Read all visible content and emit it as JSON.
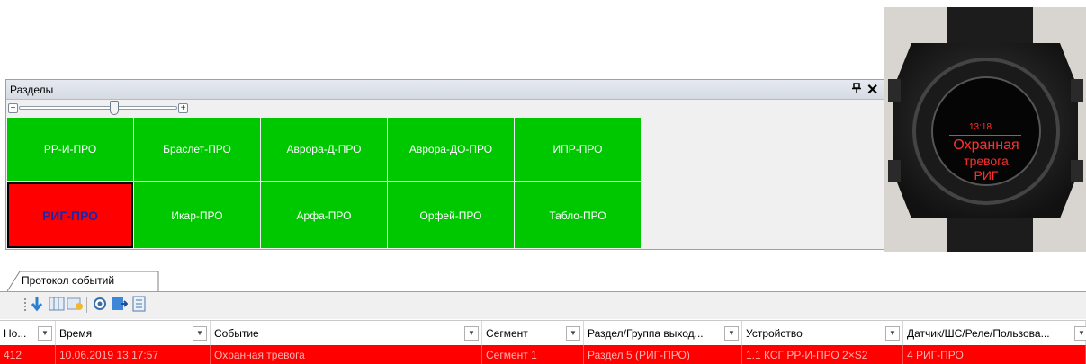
{
  "sections_panel": {
    "title": "Разделы",
    "pin_glyph": "ꟼ",
    "close_glyph": "✕",
    "zoom": {
      "minus": "−",
      "plus": "+",
      "level": 0.6
    },
    "tiles": [
      {
        "label": "РР-И-ПРО",
        "state": "normal"
      },
      {
        "label": "Браслет-ПРО",
        "state": "normal"
      },
      {
        "label": "Аврора-Д-ПРО",
        "state": "normal"
      },
      {
        "label": "Аврора-ДО-ПРО",
        "state": "normal"
      },
      {
        "label": "ИПР-ПРО",
        "state": "normal"
      },
      {
        "label": "РИГ-ПРО",
        "state": "alarm"
      },
      {
        "label": "Икар-ПРО",
        "state": "normal"
      },
      {
        "label": "Арфа-ПРО",
        "state": "normal"
      },
      {
        "label": "Орфей-ПРО",
        "state": "normal"
      },
      {
        "label": "Табло-ПРО",
        "state": "normal"
      }
    ],
    "colors": {
      "normal": "#00c800",
      "alarm": "#ff0000"
    }
  },
  "watch": {
    "time": "13:18",
    "line1": "Охранная",
    "line2": "тревога",
    "line3": "РИГ"
  },
  "protocol": {
    "tab_label": "Протокол событий",
    "toolbar_icons": [
      "down-arrow-icon",
      "columns-icon",
      "clear-icon",
      "record-icon",
      "export-icon",
      "settings-icon"
    ],
    "columns": [
      "Но...",
      "Время",
      "Событие",
      "Сегмент",
      "Раздел/Группа выход...",
      "Устройство",
      "Датчик/ШС/Реле/Пользова..."
    ],
    "rows": [
      {
        "number": "412",
        "time": "10.06.2019 13:17:57",
        "event": "Охранная тревога",
        "segment": "Сегмент 1",
        "section": "Раздел 5 (РИГ-ПРО)",
        "device": "1.1 КСГ РР-И-ПРО 2×S2",
        "sensor": "4 РИГ-ПРО"
      }
    ]
  }
}
